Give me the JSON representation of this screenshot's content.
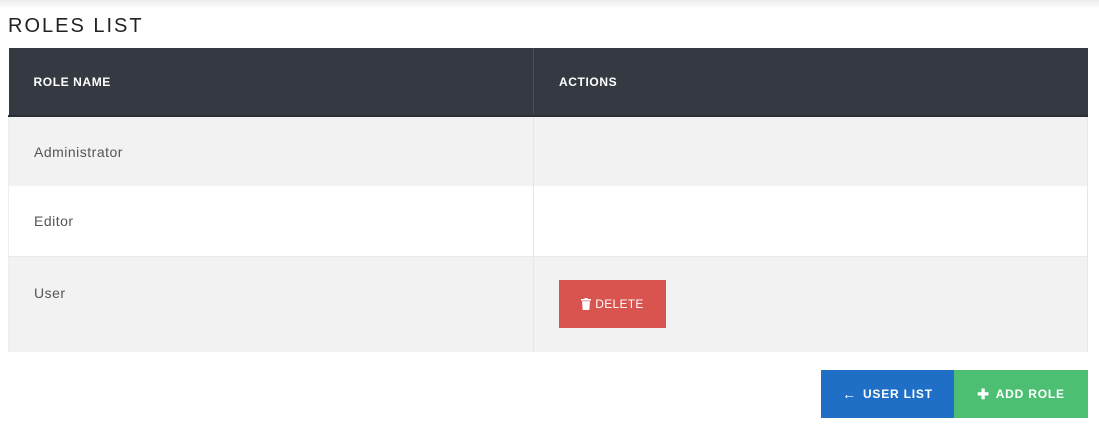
{
  "page": {
    "title": "ROLES LIST"
  },
  "table": {
    "headers": {
      "role_name": "ROLE NAME",
      "actions": "ACTIONS"
    },
    "rows": [
      {
        "role_name": "Administrator"
      },
      {
        "role_name": "Editor"
      },
      {
        "role_name": "User",
        "delete_label": "DELETE"
      }
    ]
  },
  "footer": {
    "user_list_label": "USER LIST",
    "add_role_label": "ADD ROLE"
  },
  "icons": {
    "delete": "trash-icon",
    "user_list": "arrow-left-icon",
    "add_role": "plus-icon"
  },
  "colors": {
    "header_bg": "#353a42",
    "delete": "#d9534f",
    "user_list": "#1f6fc6",
    "add_role": "#4cbf73"
  }
}
